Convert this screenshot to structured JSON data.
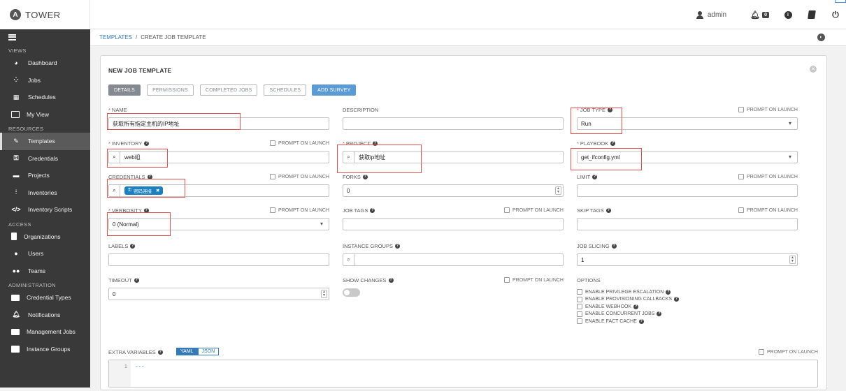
{
  "app": {
    "logo_letter": "A",
    "name": "TOWER"
  },
  "header": {
    "user": "admin",
    "notifications_count": "0"
  },
  "sidebar": {
    "sections": {
      "views": "VIEWS",
      "resources": "RESOURCES",
      "access": "ACCESS",
      "administration": "ADMINISTRATION"
    },
    "views": [
      "Dashboard",
      "Jobs",
      "Schedules",
      "My View"
    ],
    "resources": [
      "Templates",
      "Credentials",
      "Projects",
      "Inventories",
      "Inventory Scripts"
    ],
    "access": [
      "Organizations",
      "Users",
      "Teams"
    ],
    "administration": [
      "Credential Types",
      "Notifications",
      "Management Jobs",
      "Instance Groups"
    ],
    "active": "Templates"
  },
  "breadcrumb": {
    "root": "TEMPLATES",
    "separator": "/",
    "current": "CREATE JOB TEMPLATE"
  },
  "panel": {
    "title": "NEW JOB TEMPLATE",
    "tabs": [
      "DETAILS",
      "PERMISSIONS",
      "COMPLETED JOBS",
      "SCHEDULES",
      "ADD SURVEY"
    ],
    "active_tab": "DETAILS"
  },
  "form": {
    "prompt_on_launch": "PROMPT ON LAUNCH",
    "name": {
      "label": "NAME",
      "value": "获取所有指定主机的IP地址"
    },
    "description": {
      "label": "DESCRIPTION",
      "value": ""
    },
    "job_type": {
      "label": "JOB TYPE",
      "value": "Run"
    },
    "inventory": {
      "label": "INVENTORY",
      "value": "web组"
    },
    "project": {
      "label": "PROJECT",
      "value": "获取ip地址"
    },
    "playbook": {
      "label": "PLAYBOOK",
      "value": "get_ifconfig.yml"
    },
    "credentials": {
      "label": "CREDENTIALS",
      "chip": "密码连接"
    },
    "forks": {
      "label": "FORKS",
      "value": "0"
    },
    "limit": {
      "label": "LIMIT",
      "value": ""
    },
    "verbosity": {
      "label": "VERBOSITY",
      "value": "0 (Normal)"
    },
    "job_tags": {
      "label": "JOB TAGS",
      "value": ""
    },
    "skip_tags": {
      "label": "SKIP TAGS",
      "value": ""
    },
    "labels": {
      "label": "LABELS",
      "value": ""
    },
    "instance_groups": {
      "label": "INSTANCE GROUPS",
      "value": ""
    },
    "job_slicing": {
      "label": "JOB SLICING",
      "value": "1"
    },
    "timeout": {
      "label": "TIMEOUT",
      "value": "0"
    },
    "show_changes": {
      "label": "SHOW CHANGES",
      "on": false
    },
    "options": {
      "label": "OPTIONS",
      "items": [
        "ENABLE PRIVILEGE ESCALATION",
        "ENABLE PROVISIONING CALLBACKS",
        "ENABLE WEBHOOK",
        "ENABLE CONCURRENT JOBS",
        "ENABLE FACT CACHE"
      ]
    },
    "extra_variables": {
      "label": "EXTRA VARIABLES",
      "yaml": "YAML",
      "json": "JSON",
      "line_number": "1",
      "content": "---"
    }
  }
}
